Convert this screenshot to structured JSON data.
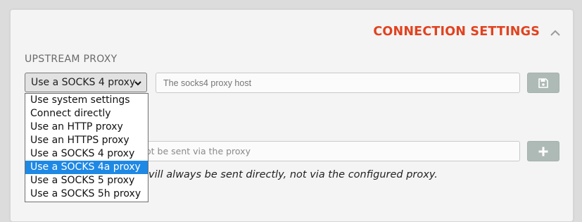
{
  "section": {
    "title": "CONNECTION SETTINGS"
  },
  "upstream": {
    "label": "UPSTREAM PROXY",
    "selected": "Use a SOCKS 4 proxy",
    "host_placeholder": "The socks4 proxy host",
    "options": [
      "Use system settings",
      "Connect directly",
      "Use an HTTP proxy",
      "Use an HTTPS proxy",
      "Use a SOCKS 4 proxy",
      "Use a SOCKS 4a proxy",
      "Use a SOCKS 5 proxy",
      "Use a SOCKS 5h proxy"
    ],
    "highlighted_option": "Use a SOCKS 4a proxy"
  },
  "no_proxy": {
    "input_visible_text": "ot be sent via the proxy",
    "hint_visible_text": "vill always be sent directly, not via the configured proxy."
  },
  "icons": {
    "collapse": "chevron-up-icon",
    "save": "save-icon",
    "add": "plus-icon",
    "select": "chevron-down-icon"
  },
  "colors": {
    "accent": "#e1421f",
    "button": "#aebab5",
    "highlight": "#1e88e5"
  }
}
